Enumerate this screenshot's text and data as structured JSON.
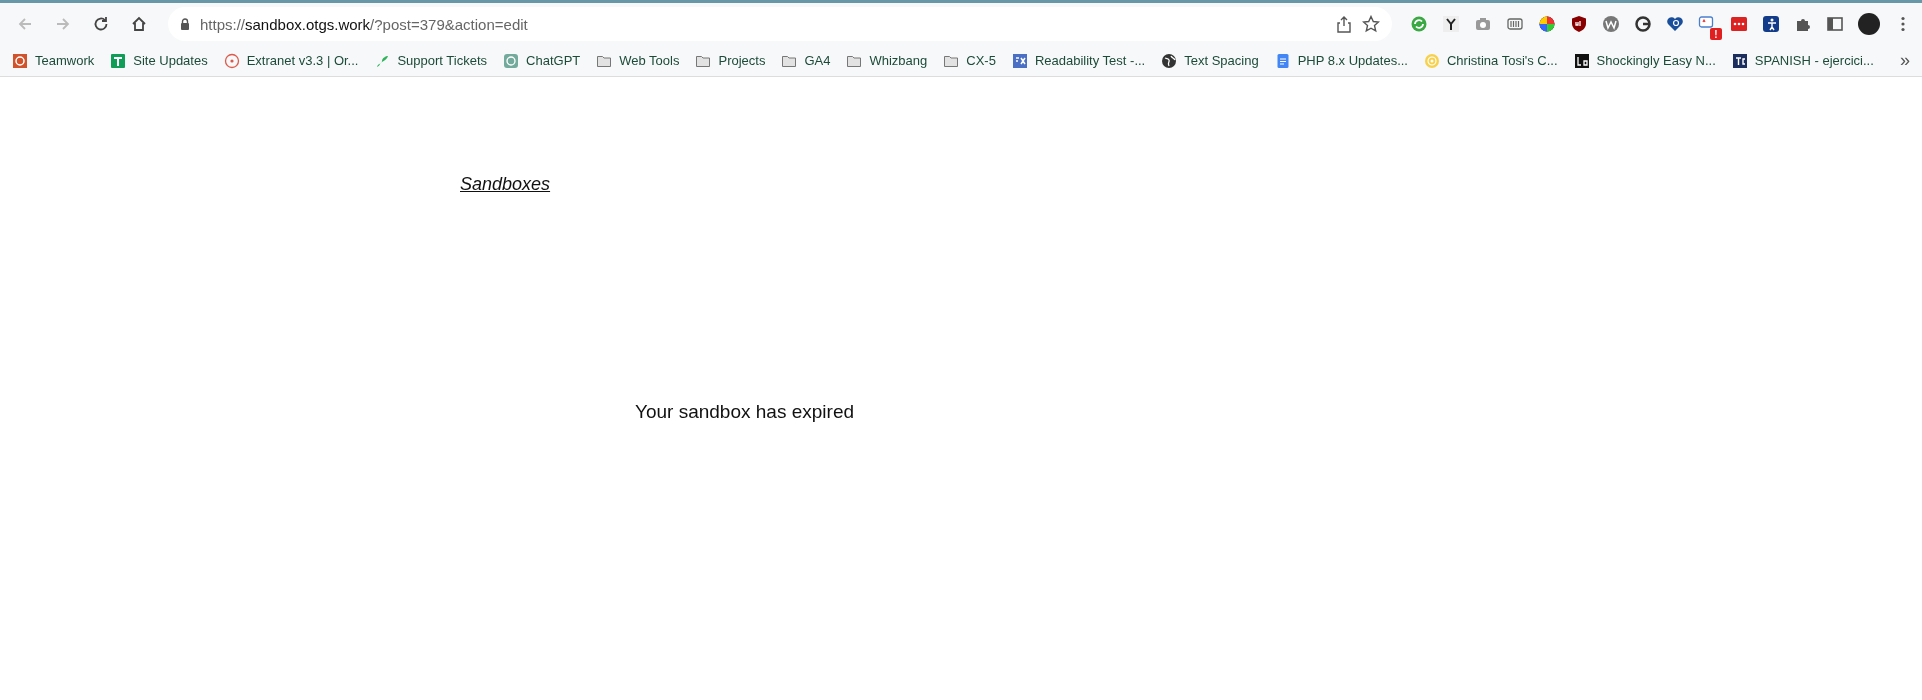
{
  "address_bar": {
    "scheme": "https://",
    "host": "sandbox.otgs.work",
    "path": "/?post=379&action=edit"
  },
  "nav": {
    "back_disabled": true,
    "forward_disabled": true
  },
  "extension_badge": "!",
  "bookmarks": [
    {
      "label": "Teamwork",
      "kind": "page"
    },
    {
      "label": "Site Updates",
      "kind": "page"
    },
    {
      "label": "Extranet v3.3 | Or...",
      "kind": "page"
    },
    {
      "label": "Support Tickets",
      "kind": "page"
    },
    {
      "label": "ChatGPT",
      "kind": "page"
    },
    {
      "label": "Web Tools",
      "kind": "folder"
    },
    {
      "label": "Projects",
      "kind": "folder"
    },
    {
      "label": "GA4",
      "kind": "folder"
    },
    {
      "label": "Whizbang",
      "kind": "folder"
    },
    {
      "label": "CX-5",
      "kind": "folder"
    },
    {
      "label": "Readability Test -...",
      "kind": "page"
    },
    {
      "label": "Text Spacing",
      "kind": "page"
    },
    {
      "label": "PHP 8.x Updates...",
      "kind": "page"
    },
    {
      "label": "Christina Tosi's C...",
      "kind": "page"
    },
    {
      "label": "Shockingly Easy N...",
      "kind": "page"
    },
    {
      "label": "SPANISH - ejercici...",
      "kind": "page"
    }
  ],
  "overflow": "»",
  "page": {
    "link": "Sandboxes",
    "message": "Your sandbox has expired"
  }
}
